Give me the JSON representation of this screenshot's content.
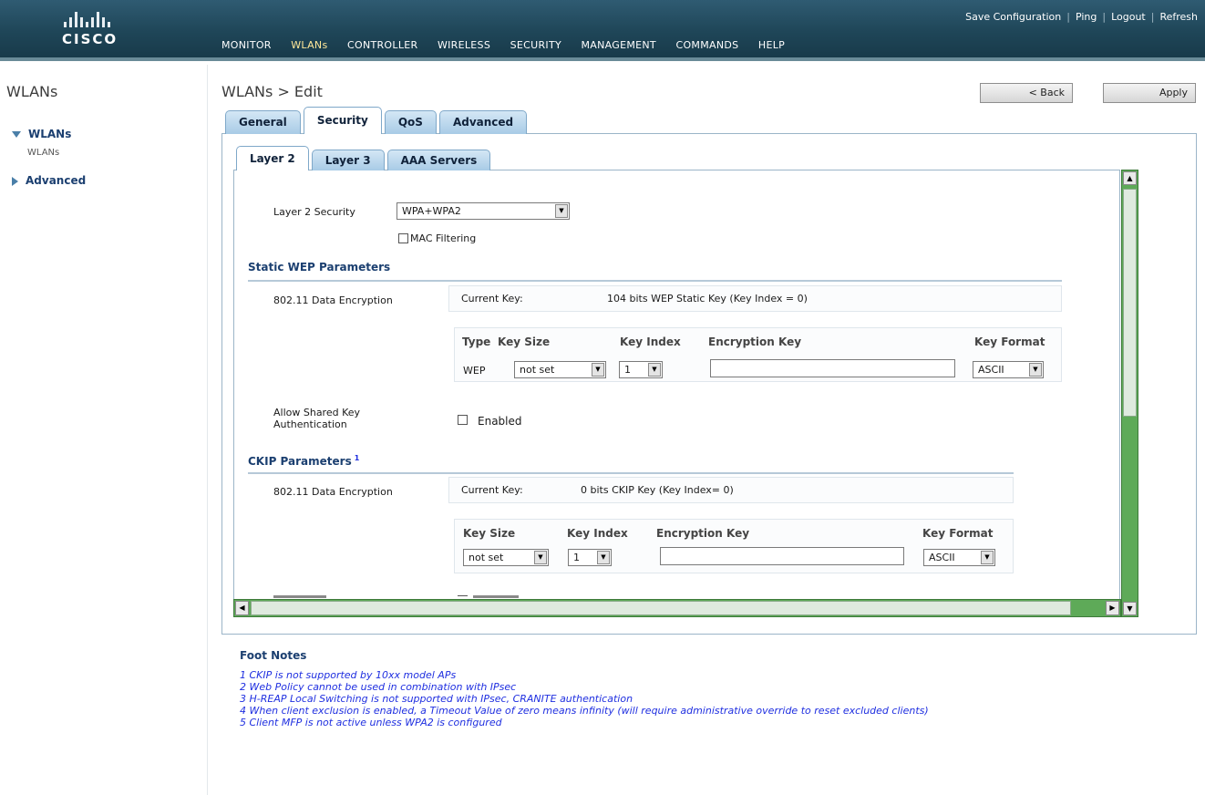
{
  "header": {
    "logo_text": "CISCO",
    "utility_links": [
      "Save Configuration",
      "Ping",
      "Logout",
      "Refresh"
    ],
    "nav": [
      "MONITOR",
      "WLANs",
      "CONTROLLER",
      "WIRELESS",
      "SECURITY",
      "MANAGEMENT",
      "COMMANDS",
      "HELP"
    ],
    "active_nav": "WLANs",
    "corner_tag": "(  )"
  },
  "sidebar": {
    "title": "WLANs",
    "items": [
      {
        "label": "WLANs",
        "sub": "WLANs"
      },
      {
        "label": "Advanced"
      }
    ]
  },
  "main": {
    "title": "WLANs > Edit",
    "back_label": "< Back",
    "apply_label": "Apply",
    "tabs": [
      "General",
      "Security",
      "QoS",
      "Advanced"
    ],
    "active_tab": "Security",
    "subtabs": [
      "Layer 2",
      "Layer 3",
      "AAA Servers"
    ],
    "active_subtab": "Layer 2"
  },
  "layer2": {
    "security_label": "Layer 2 Security",
    "security_value": "WPA+WPA2",
    "mac_filtering_label": "MAC Filtering",
    "static_wep": {
      "heading": "Static WEP Parameters",
      "encryption_label": "802.11 Data Encryption",
      "current_key_label": "Current Key:",
      "current_key_value": "104 bits WEP Static Key (Key Index = 0)",
      "columns": [
        "Type",
        "Key Size",
        "Key Index",
        "Encryption Key",
        "Key Format"
      ],
      "type_value": "WEP",
      "key_size": "not set",
      "key_index": "1",
      "key_format": "ASCII"
    },
    "shared_key": {
      "label": "Allow Shared Key Authentication",
      "line1": "Allow Shared Key",
      "line2": "Authentication",
      "checkbox_label": "Enabled"
    },
    "ckip": {
      "heading": "CKIP Parameters",
      "footnote_ref": "1",
      "encryption_label": "802.11 Data Encryption",
      "current_key_label": "Current Key:",
      "current_key_value": "0 bits CKIP Key (Key Index= 0)",
      "columns": [
        "Key Size",
        "Key Index",
        "Encryption Key",
        "Key Format"
      ],
      "key_size": "not set",
      "key_index": "1",
      "key_format": "ASCII"
    }
  },
  "footnotes": {
    "title": "Foot Notes",
    "items": [
      "1 CKIP is not supported by 10xx model APs",
      "2 Web Policy cannot be used in combination with IPsec",
      "3 H-REAP Local Switching is not supported with IPsec, CRANITE authentication",
      "4 When client exclusion is enabled, a Timeout Value of zero means infinity (will require administrative override to reset excluded clients)",
      "5 Client MFP is not active unless WPA2 is configured"
    ]
  }
}
